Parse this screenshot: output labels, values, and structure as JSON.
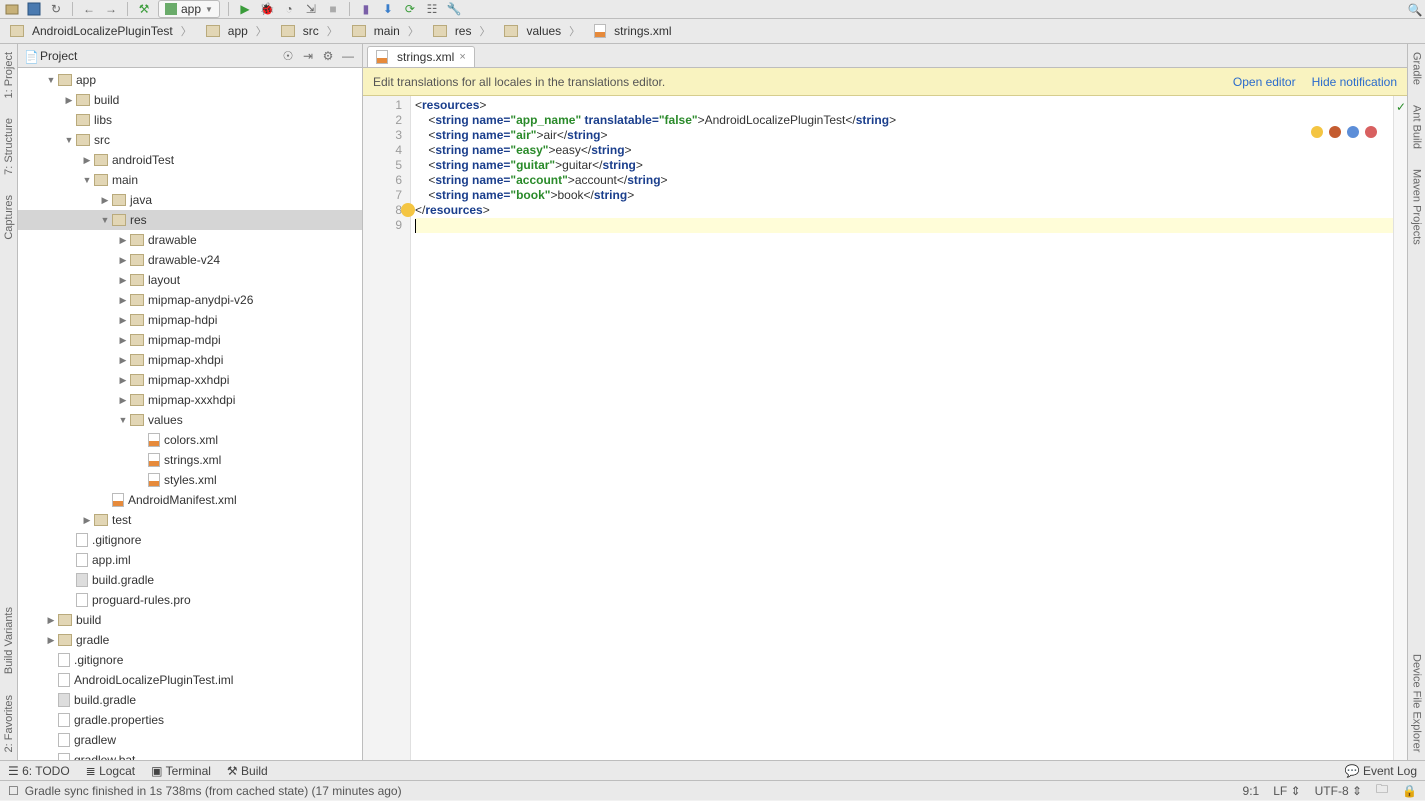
{
  "toolbar": {
    "config_label": "app"
  },
  "breadcrumb": [
    "AndroidLocalizePluginTest",
    "app",
    "src",
    "main",
    "res",
    "values",
    "strings.xml"
  ],
  "project": {
    "title": "Project",
    "tree": [
      {
        "d": 0,
        "a": "▼",
        "t": "folder",
        "l": "app"
      },
      {
        "d": 1,
        "a": "▶",
        "t": "folder",
        "l": "build"
      },
      {
        "d": 1,
        "a": "",
        "t": "folder",
        "l": "libs"
      },
      {
        "d": 1,
        "a": "▼",
        "t": "folder",
        "l": "src"
      },
      {
        "d": 2,
        "a": "▶",
        "t": "folder",
        "l": "androidTest"
      },
      {
        "d": 2,
        "a": "▼",
        "t": "folder",
        "l": "main"
      },
      {
        "d": 3,
        "a": "▶",
        "t": "folder",
        "l": "java"
      },
      {
        "d": 3,
        "a": "▼",
        "t": "folder",
        "l": "res",
        "sel": true
      },
      {
        "d": 4,
        "a": "▶",
        "t": "folder",
        "l": "drawable"
      },
      {
        "d": 4,
        "a": "▶",
        "t": "folder",
        "l": "drawable-v24"
      },
      {
        "d": 4,
        "a": "▶",
        "t": "folder",
        "l": "layout"
      },
      {
        "d": 4,
        "a": "▶",
        "t": "folder",
        "l": "mipmap-anydpi-v26"
      },
      {
        "d": 4,
        "a": "▶",
        "t": "folder",
        "l": "mipmap-hdpi"
      },
      {
        "d": 4,
        "a": "▶",
        "t": "folder",
        "l": "mipmap-mdpi"
      },
      {
        "d": 4,
        "a": "▶",
        "t": "folder",
        "l": "mipmap-xhdpi"
      },
      {
        "d": 4,
        "a": "▶",
        "t": "folder",
        "l": "mipmap-xxhdpi"
      },
      {
        "d": 4,
        "a": "▶",
        "t": "folder",
        "l": "mipmap-xxxhdpi"
      },
      {
        "d": 4,
        "a": "▼",
        "t": "folder",
        "l": "values"
      },
      {
        "d": 5,
        "a": "",
        "t": "xml",
        "l": "colors.xml"
      },
      {
        "d": 5,
        "a": "",
        "t": "xml",
        "l": "strings.xml"
      },
      {
        "d": 5,
        "a": "",
        "t": "xml",
        "l": "styles.xml"
      },
      {
        "d": 3,
        "a": "",
        "t": "xml",
        "l": "AndroidManifest.xml"
      },
      {
        "d": 2,
        "a": "▶",
        "t": "folder",
        "l": "test"
      },
      {
        "d": 1,
        "a": "",
        "t": "file",
        "l": ".gitignore"
      },
      {
        "d": 1,
        "a": "",
        "t": "file",
        "l": "app.iml"
      },
      {
        "d": 1,
        "a": "",
        "t": "grd",
        "l": "build.gradle"
      },
      {
        "d": 1,
        "a": "",
        "t": "file",
        "l": "proguard-rules.pro"
      },
      {
        "d": 0,
        "a": "▶",
        "t": "folder",
        "l": "build"
      },
      {
        "d": 0,
        "a": "▶",
        "t": "folder",
        "l": "gradle"
      },
      {
        "d": 0,
        "a": "",
        "t": "file",
        "l": ".gitignore"
      },
      {
        "d": 0,
        "a": "",
        "t": "file",
        "l": "AndroidLocalizePluginTest.iml"
      },
      {
        "d": 0,
        "a": "",
        "t": "grd",
        "l": "build.gradle"
      },
      {
        "d": 0,
        "a": "",
        "t": "file",
        "l": "gradle.properties"
      },
      {
        "d": 0,
        "a": "",
        "t": "file",
        "l": "gradlew"
      },
      {
        "d": 0,
        "a": "",
        "t": "file",
        "l": "gradlew.bat"
      }
    ]
  },
  "tab": {
    "label": "strings.xml"
  },
  "banner": {
    "msg": "Edit translations for all locales in the translations editor.",
    "open": "Open editor",
    "hide": "Hide notification"
  },
  "code": {
    "lines": [
      1,
      2,
      3,
      4,
      5,
      6,
      7,
      8,
      9
    ],
    "strings": [
      {
        "name": "app_name",
        "extra": "translatable=\"false\"",
        "text": "AndroidLocalizePluginTest"
      },
      {
        "name": "air",
        "text": "air"
      },
      {
        "name": "easy",
        "text": "easy"
      },
      {
        "name": "guitar",
        "text": "guitar"
      },
      {
        "name": "account",
        "text": "account"
      },
      {
        "name": "book",
        "text": "book"
      }
    ]
  },
  "left_tabs": [
    "1: Project",
    "7: Structure",
    "Captures"
  ],
  "left_tabs2": [
    "Build Variants",
    "2: Favorites"
  ],
  "right_tabs": [
    "Gradle",
    "Ant Build",
    "Maven Projects",
    "Device File Explorer"
  ],
  "toolwins": {
    "todo": "6: TODO",
    "logcat": "Logcat",
    "terminal": "Terminal",
    "build": "Build",
    "eventlog": "Event Log"
  },
  "status": {
    "msg": "Gradle sync finished in 1s 738ms (from cached state) (17 minutes ago)",
    "pos": "9:1",
    "lf": "LF",
    "enc": "UTF-8"
  }
}
